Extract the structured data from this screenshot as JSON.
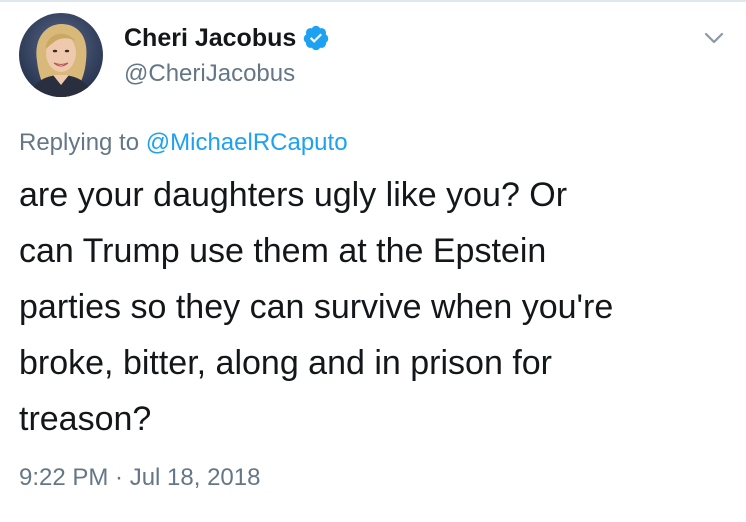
{
  "tweet": {
    "author": {
      "display_name": "Cheri Jacobus",
      "handle": "@CheriJacobus",
      "verified": true,
      "verified_icon": "verified-badge-icon"
    },
    "menu_icon": "chevron-down-icon",
    "replying": {
      "prefix": "Replying to ",
      "mention": "@MichaelRCaputo"
    },
    "text_lines": [
      "are your daughters ugly like you?  Or",
      "can Trump use them at the Epstein",
      "parties so they can survive when you're",
      "broke, bitter, along and in prison for",
      "treason?"
    ],
    "timestamp": "9:22 PM · Jul 18, 2018"
  },
  "colors": {
    "text_primary": "#14171a",
    "text_secondary": "#657786",
    "accent_blue": "#1da1f2",
    "divider": "#e1e8ed"
  }
}
